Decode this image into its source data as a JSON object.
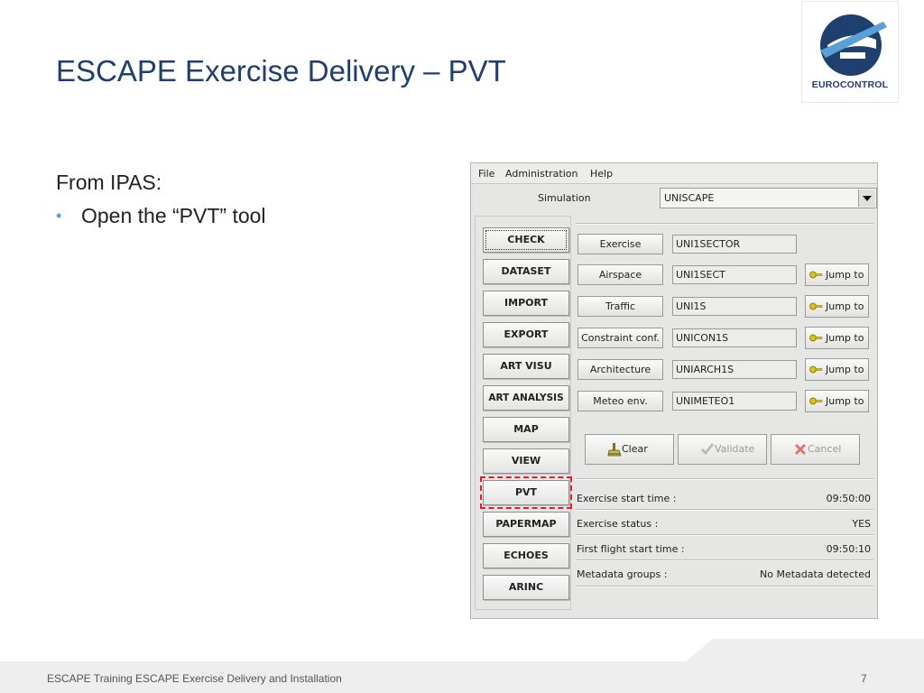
{
  "slide": {
    "title": "ESCAPE Exercise Delivery – PVT",
    "intro": "From IPAS:",
    "bullet": "Open the “PVT” tool",
    "footer": "ESCAPE Training ESCAPE Exercise Delivery and Installation",
    "page_number": "7",
    "logo_text": "EUROCONTROL"
  },
  "colors": {
    "title": "#1f3f6e",
    "bullet": "#5aa0d8",
    "highlight": "#e0202a",
    "logo_blue": "#1f3f6e",
    "logo_light": "#5aa0d8"
  },
  "app": {
    "menu": [
      "File",
      "Administration",
      "Help"
    ],
    "simulation_label": "Simulation",
    "simulation_value": "UNISCAPE",
    "modules": [
      "CHECK",
      "DATASET",
      "IMPORT",
      "EXPORT",
      "ART VISU",
      "ART ANALYSIS",
      "MAP",
      "VIEW",
      "PVT",
      "PAPERMAP",
      "ECHOES",
      "ARINC"
    ],
    "fields": [
      {
        "label": "Exercise",
        "value": "UNI1SECTOR",
        "jump": ""
      },
      {
        "label": "Airspace",
        "value": "UNI1SECT",
        "jump": "Jump to"
      },
      {
        "label": "Traffic",
        "value": "UNI1S",
        "jump": "Jump to"
      },
      {
        "label": "Constraint conf.",
        "value": "UNICON1S",
        "jump": "Jump to"
      },
      {
        "label": "Architecture",
        "value": "UNIARCH1S",
        "jump": "Jump to"
      },
      {
        "label": "Meteo env.",
        "value": "UNIMETEO1",
        "jump": "Jump to"
      }
    ],
    "actions": {
      "clear": "Clear",
      "validate": "Validate",
      "cancel": "Cancel"
    },
    "info": [
      {
        "label": "Exercise start time :",
        "value": "09:50:00"
      },
      {
        "label": "Exercise status :",
        "value": "YES"
      },
      {
        "label": "First flight start time :",
        "value": "09:50:10"
      },
      {
        "label": "Metadata groups :",
        "value": "No Metadata detected"
      }
    ]
  }
}
